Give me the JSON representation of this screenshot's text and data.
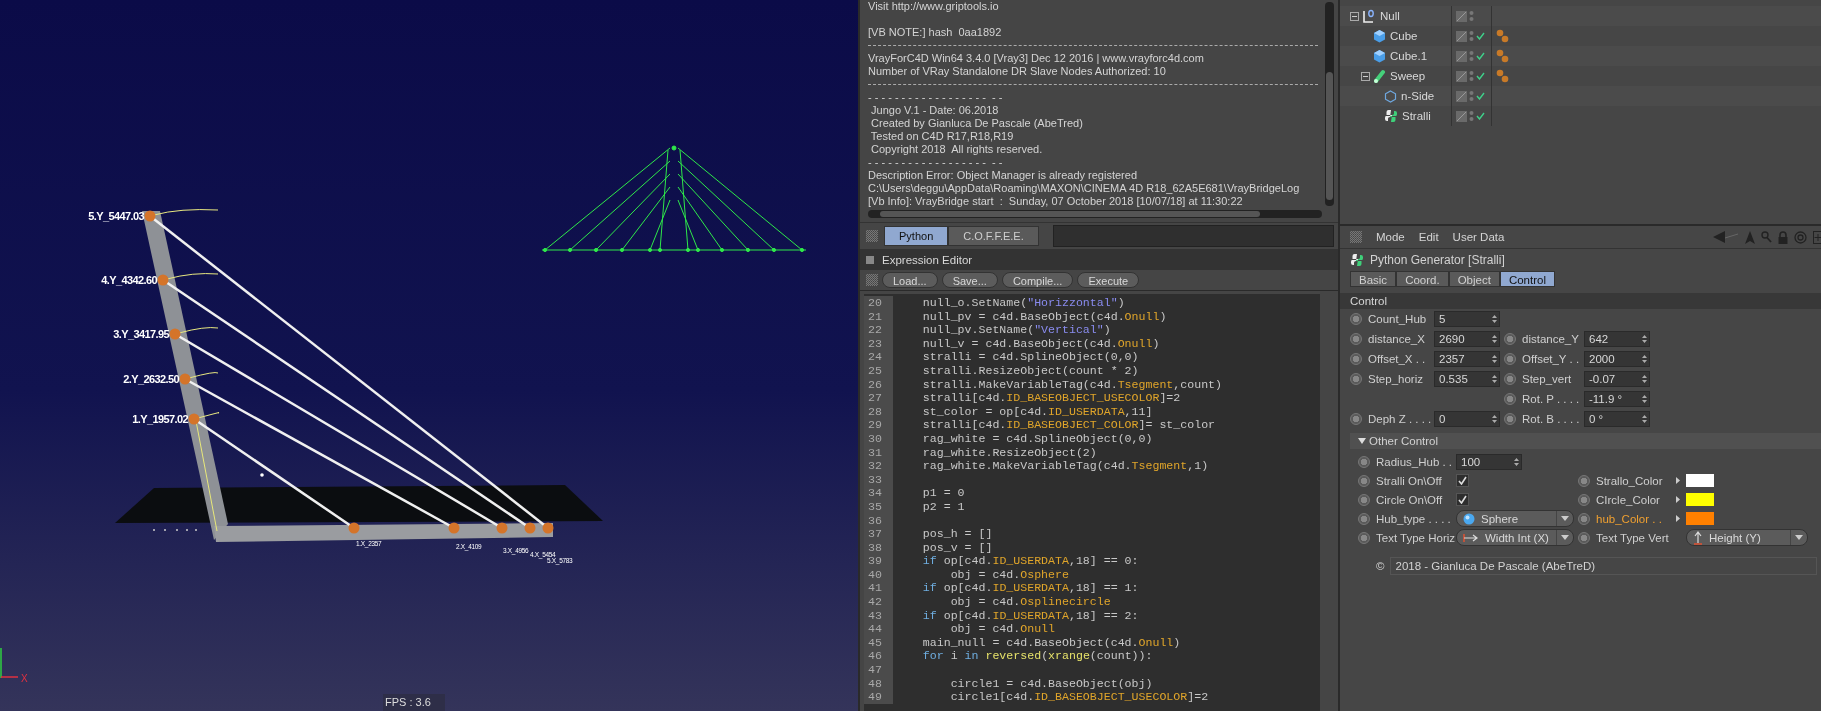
{
  "viewport": {
    "height_labels": [
      "5.Y_5447.03",
      "4.Y_4342.60",
      "3.Y_3417.95",
      "2.Y_2632.50",
      "1.Y_1957.02"
    ],
    "deck_labels": [
      "1.X_2357",
      "2.X_4109",
      "3.X_4956",
      "4.X_5454",
      "5.X_5783"
    ],
    "axis_label": "X",
    "fps": "FPS : 3.6"
  },
  "console": {
    "lines": [
      {
        "kind": "text",
        "text": "Visit http://www.griptools.io"
      },
      {
        "kind": "spaced",
        "text": "[VB NOTE:] hash  0aa1892"
      },
      {
        "kind": "rule"
      },
      {
        "kind": "text",
        "text": "VrayForC4D Win64 3.4.0 [Vray3] Dec 12 2016 | www.vrayforc4d.com"
      },
      {
        "kind": "text",
        "text": "Number of VRay Standalone DR Slave Nodes Authorized: 10"
      },
      {
        "kind": "rule"
      },
      {
        "kind": "text",
        "text": "- - - - - - - - - - - - - - - - - -  - -"
      },
      {
        "kind": "text",
        "text": " Jungo V.1 - Date: 06.2018"
      },
      {
        "kind": "text",
        "text": " Created by Gianluca De Pascale (AbeTred)"
      },
      {
        "kind": "text",
        "text": " Tested on C4D R17,R18,R19"
      },
      {
        "kind": "text",
        "text": " Copyright 2018  All rights reserved."
      },
      {
        "kind": "text",
        "text": "- - - - - - - - - - - - - - - - - -  - -"
      },
      {
        "kind": "text",
        "text": "Description Error: Object Manager is already registered"
      },
      {
        "kind": "text",
        "text": "C:\\Users\\deggu\\AppData\\Roaming\\MAXON\\CINEMA 4D R18_62A5E681\\VrayBridgeLog"
      },
      {
        "kind": "text",
        "text": "[Vb Info]: VrayBridge start  :  Sunday, 07 October 2018 [10/07/18] at 11:30:22"
      }
    ],
    "language_tabs": [
      {
        "label": "Python",
        "selected": true
      },
      {
        "label": "C.O.F.F.E.E.",
        "selected": false
      }
    ]
  },
  "expression_editor": {
    "title": "Expression Editor",
    "buttons": [
      "Load...",
      "Save...",
      "Compile...",
      "Execute"
    ],
    "lines": [
      {
        "number": "20",
        "segments": [
          {
            "kind": "plain",
            "text": "    null_o.SetName("
          },
          {
            "kind": "string",
            "text": "\"Horizzontal\""
          },
          {
            "kind": "plain",
            "text": ")"
          }
        ]
      },
      {
        "number": "21",
        "segments": [
          {
            "kind": "plain",
            "text": "    null_pv = c4d.BaseObject(c4d."
          },
          {
            "kind": "const",
            "text": "Onull"
          },
          {
            "kind": "plain",
            "text": ")"
          }
        ]
      },
      {
        "number": "22",
        "segments": [
          {
            "kind": "plain",
            "text": "    null_pv.SetName("
          },
          {
            "kind": "string",
            "text": "\"Vertical\""
          },
          {
            "kind": "plain",
            "text": ")"
          }
        ]
      },
      {
        "number": "23",
        "segments": [
          {
            "kind": "plain",
            "text": "    null_v = c4d.BaseObject(c4d."
          },
          {
            "kind": "const",
            "text": "Onull"
          },
          {
            "kind": "plain",
            "text": ")"
          }
        ]
      },
      {
        "number": "24",
        "segments": [
          {
            "kind": "plain",
            "text": "    stralli = c4d.SplineObject(0,0)"
          }
        ]
      },
      {
        "number": "25",
        "segments": [
          {
            "kind": "plain",
            "text": "    stralli.ResizeObject(count * 2)"
          }
        ]
      },
      {
        "number": "26",
        "segments": [
          {
            "kind": "plain",
            "text": "    stralli.MakeVariableTag(c4d."
          },
          {
            "kind": "const",
            "text": "Tsegment"
          },
          {
            "kind": "plain",
            "text": ",count)"
          }
        ]
      },
      {
        "number": "27",
        "segments": [
          {
            "kind": "plain",
            "text": "    stralli[c4d."
          },
          {
            "kind": "const",
            "text": "ID_BASEOBJECT_USECOLOR"
          },
          {
            "kind": "plain",
            "text": "]=2"
          }
        ]
      },
      {
        "number": "28",
        "segments": [
          {
            "kind": "plain",
            "text": "    st_color = op[c4d."
          },
          {
            "kind": "const",
            "text": "ID_USERDATA"
          },
          {
            "kind": "plain",
            "text": ",11]"
          }
        ]
      },
      {
        "number": "29",
        "segments": [
          {
            "kind": "plain",
            "text": "    stralli[c4d."
          },
          {
            "kind": "const",
            "text": "ID_BASEOBJECT_COLOR"
          },
          {
            "kind": "plain",
            "text": "]= st_color"
          }
        ]
      },
      {
        "number": "30",
        "segments": [
          {
            "kind": "plain",
            "text": "    rag_white = c4d.SplineObject(0,0)"
          }
        ]
      },
      {
        "number": "31",
        "segments": [
          {
            "kind": "plain",
            "text": "    rag_white.ResizeObject(2)"
          }
        ]
      },
      {
        "number": "32",
        "segments": [
          {
            "kind": "plain",
            "text": "    rag_white.MakeVariableTag(c4d."
          },
          {
            "kind": "const",
            "text": "Tsegment"
          },
          {
            "kind": "plain",
            "text": ",1)"
          }
        ]
      },
      {
        "number": "33"
      },
      {
        "number": "34",
        "segments": [
          {
            "kind": "plain",
            "text": "    p1 = 0"
          }
        ]
      },
      {
        "number": "35",
        "segments": [
          {
            "kind": "plain",
            "text": "    p2 = 1"
          }
        ]
      },
      {
        "number": "36"
      },
      {
        "number": "37",
        "segments": [
          {
            "kind": "plain",
            "text": "    pos_h = []"
          }
        ]
      },
      {
        "number": "38",
        "segments": [
          {
            "kind": "plain",
            "text": "    pos_v = []"
          }
        ]
      },
      {
        "number": "39",
        "segments": [
          {
            "kind": "keyword",
            "text": "    if"
          },
          {
            "kind": "plain",
            "text": " op[c4d."
          },
          {
            "kind": "const",
            "text": "ID_USERDATA"
          },
          {
            "kind": "plain",
            "text": ",18] == 0:"
          }
        ]
      },
      {
        "number": "40",
        "segments": [
          {
            "kind": "plain",
            "text": "        obj = c4d."
          },
          {
            "kind": "const",
            "text": "Osphere"
          }
        ]
      },
      {
        "number": "41",
        "segments": [
          {
            "kind": "keyword",
            "text": "    if"
          },
          {
            "kind": "plain",
            "text": " op[c4d."
          },
          {
            "kind": "const",
            "text": "ID_USERDATA"
          },
          {
            "kind": "plain",
            "text": ",18] == 1:"
          }
        ]
      },
      {
        "number": "42",
        "segments": [
          {
            "kind": "plain",
            "text": "        obj = c4d."
          },
          {
            "kind": "const",
            "text": "Osplinecircle"
          }
        ]
      },
      {
        "number": "43",
        "segments": [
          {
            "kind": "keyword",
            "text": "    if"
          },
          {
            "kind": "plain",
            "text": " op[c4d."
          },
          {
            "kind": "const",
            "text": "ID_USERDATA"
          },
          {
            "kind": "plain",
            "text": ",18] == 2:"
          }
        ]
      },
      {
        "number": "44",
        "segments": [
          {
            "kind": "plain",
            "text": "        obj = c4d."
          },
          {
            "kind": "const",
            "text": "Onull"
          }
        ]
      },
      {
        "number": "45",
        "segments": [
          {
            "kind": "plain",
            "text": "    main_null = c4d.BaseObject(c4d."
          },
          {
            "kind": "const",
            "text": "Onull"
          },
          {
            "kind": "plain",
            "text": ")"
          }
        ]
      },
      {
        "number": "46",
        "segments": [
          {
            "kind": "keyword",
            "text": "    for"
          },
          {
            "kind": "plain",
            "text": " i "
          },
          {
            "kind": "keyword",
            "text": "in"
          },
          {
            "kind": "builtin",
            "text": " reversed"
          },
          {
            "kind": "plain",
            "text": "("
          },
          {
            "kind": "builtin",
            "text": "xrange"
          },
          {
            "kind": "plain",
            "text": "(count)):"
          }
        ]
      },
      {
        "number": "47"
      },
      {
        "number": "48",
        "segments": [
          {
            "kind": "plain",
            "text": "        circle1 = c4d.BaseObject(obj)"
          }
        ]
      },
      {
        "number": "49",
        "segments": [
          {
            "kind": "plain",
            "text": "        circle1[c4d."
          },
          {
            "kind": "const",
            "text": "ID_BASEOBJECT_USECOLOR"
          },
          {
            "kind": "plain",
            "text": "]=2"
          }
        ]
      }
    ]
  },
  "object_manager": {
    "objects": [
      {
        "name": "Null",
        "kind": "null",
        "expanded": true,
        "enabled": false,
        "tagged": false,
        "children": [
          {
            "name": "Cube",
            "kind": "cube",
            "enabled": true,
            "tagged": true
          },
          {
            "name": "Cube.1",
            "kind": "cube",
            "enabled": true,
            "tagged": true
          },
          {
            "name": "Sweep",
            "kind": "sweep",
            "expanded": true,
            "enabled": true,
            "tagged": true,
            "children": [
              {
                "name": "n-Side",
                "kind": "nside",
                "enabled": true,
                "tagged": false
              },
              {
                "name": "Stralli",
                "kind": "python",
                "enabled": true,
                "tagged": false
              }
            ]
          }
        ]
      }
    ]
  },
  "attributes": {
    "menu": [
      "Mode",
      "Edit",
      "User Data"
    ],
    "title": "Python Generator [Stralli]",
    "tabs": [
      {
        "label": "Basic",
        "selected": false
      },
      {
        "label": "Coord.",
        "selected": false
      },
      {
        "label": "Object",
        "selected": false
      },
      {
        "label": "Control",
        "selected": true
      }
    ],
    "section": "Control",
    "params": [
      {
        "left": {
          "label": "Count_Hub",
          "value": "5"
        }
      },
      {
        "left": {
          "label": "distance_X",
          "value": "2690"
        },
        "right": {
          "label": "distance_Y",
          "value": "642"
        }
      },
      {
        "left": {
          "label": "Offset_X . .",
          "value": "2357"
        },
        "right": {
          "label": "Offset_Y . .",
          "value": "2000"
        }
      },
      {
        "left": {
          "label": "Step_horiz",
          "value": "0.535"
        },
        "right": {
          "label": "Step_vert",
          "value": "-0.07"
        }
      },
      {
        "right": {
          "label": "Rot. P . . . .",
          "value": "-11.9 °"
        }
      },
      {
        "left": {
          "label": "Deph Z . . . .",
          "value": "0"
        },
        "right": {
          "label": "Rot. B . . . .",
          "value": "0 °"
        }
      }
    ],
    "subsection": {
      "title": "Other Control",
      "expanded": true
    },
    "other_params": [
      {
        "left": {
          "kind": "number",
          "label": "Radius_Hub . .",
          "value": "100"
        }
      },
      {
        "left": {
          "kind": "checkbox",
          "label": "Stralli On\\Off",
          "checked": true
        },
        "right": {
          "kind": "color",
          "label": "Strallo_Color",
          "color": "#ffffff",
          "highlighted": false
        }
      },
      {
        "left": {
          "kind": "checkbox",
          "label": "Circle On\\Off",
          "checked": true
        },
        "right": {
          "kind": "color",
          "label": "CIrcle_Color",
          "color": "#ffff00",
          "highlighted": false
        }
      },
      {
        "left": {
          "kind": "dropdown",
          "label": "Hub_type . . . .",
          "value": "Sphere"
        },
        "right": {
          "kind": "color",
          "label": "hub_Color . .",
          "color": "#ff8000",
          "highlighted": true
        }
      },
      {
        "left": {
          "kind": "dropdown",
          "label": "Text Type Horiz",
          "value": "Width Int (X)"
        },
        "right": {
          "kind": "dropdown",
          "label": "Text Type Vert",
          "value": "Height (Y)"
        }
      }
    ],
    "copyright_symbol": "©",
    "copyright": "2018 - Gianluca De Pascale (AbeTreD)"
  }
}
